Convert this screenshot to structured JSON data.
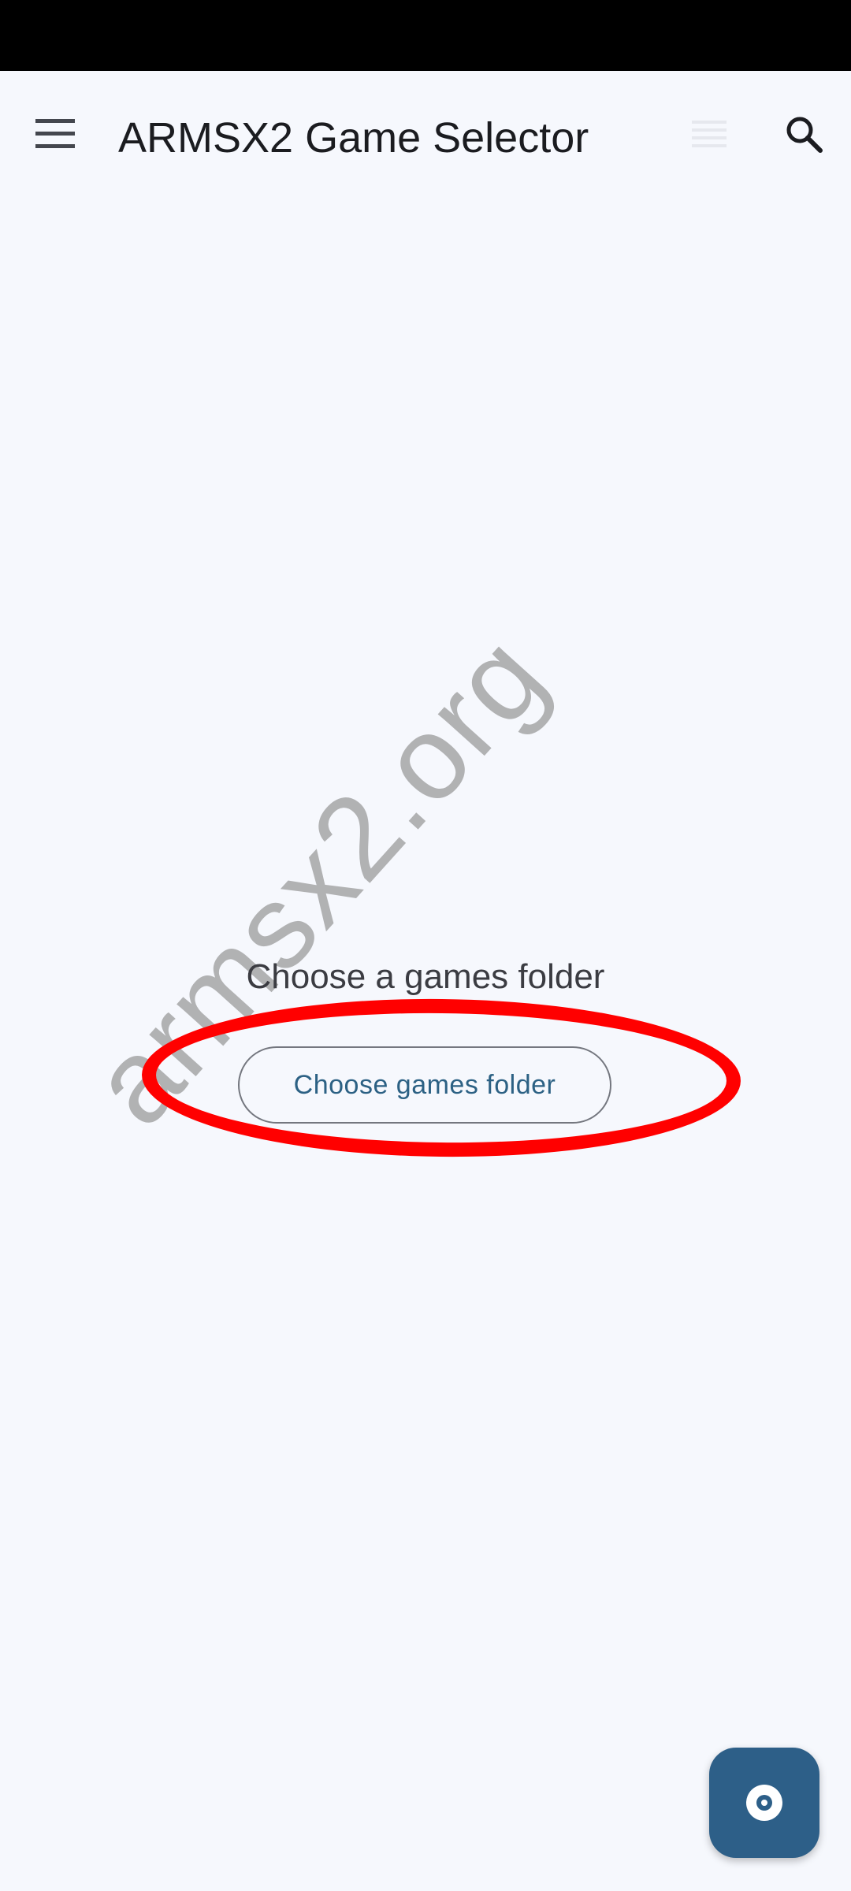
{
  "app_bar": {
    "title": "ARMSX2 Game Selector",
    "menu_icon": "hamburger-menu-icon",
    "list_icon": "list-view-icon",
    "search_icon": "search-icon"
  },
  "watermark": {
    "text": "armsx2.org"
  },
  "empty_state": {
    "message": "Choose a games folder",
    "button_label": "Choose games folder"
  },
  "fab": {
    "icon": "start-disc-icon"
  },
  "colors": {
    "background": "#f6f8fd",
    "accent": "#2d5f88",
    "button_text": "#2c6184",
    "highlight": "#ff0000"
  }
}
